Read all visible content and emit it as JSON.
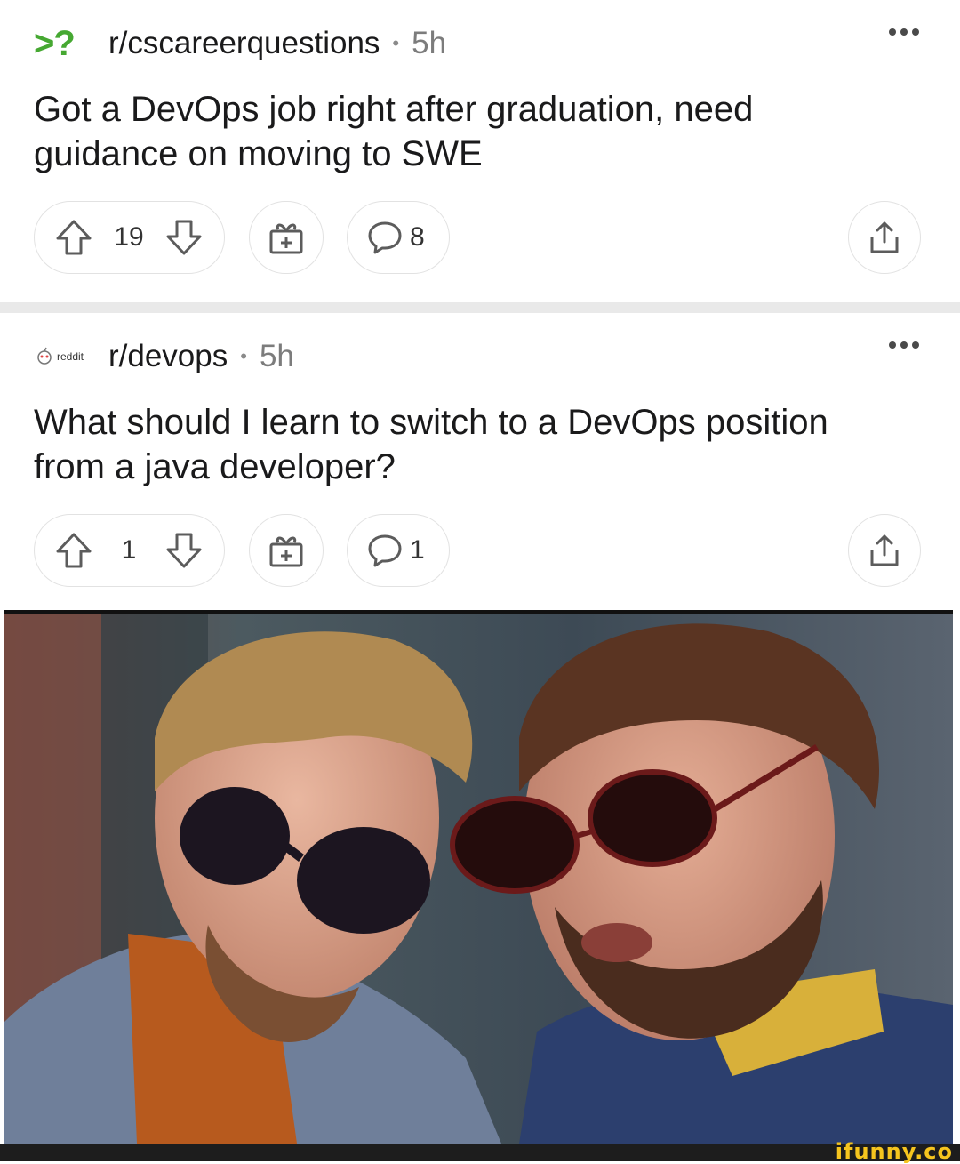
{
  "posts": [
    {
      "subreddit": "r/cscareerquestions",
      "separator": "•",
      "time": "5h",
      "title": "Got a DevOps job right after graduation, need guidance on moving to SWE",
      "votes": "19",
      "comments": "8",
      "icon": "question-icon",
      "icon_text": ">?",
      "icon_color": "#46a832"
    },
    {
      "subreddit": "r/devops",
      "separator": "•",
      "time": "5h",
      "title": "What should I learn to switch to a DevOps position from a java developer?",
      "votes": "1",
      "comments": "1",
      "icon": "reddit-logo-icon",
      "icon_text": "reddit"
    }
  ],
  "meme": {
    "description": "two men in suits wearing sunglasses"
  },
  "watermark": "ifunny.co",
  "colors": {
    "icon_stroke": "#5c5c5c",
    "separator": "#e9e9e9",
    "watermark": "#f6c51e"
  }
}
